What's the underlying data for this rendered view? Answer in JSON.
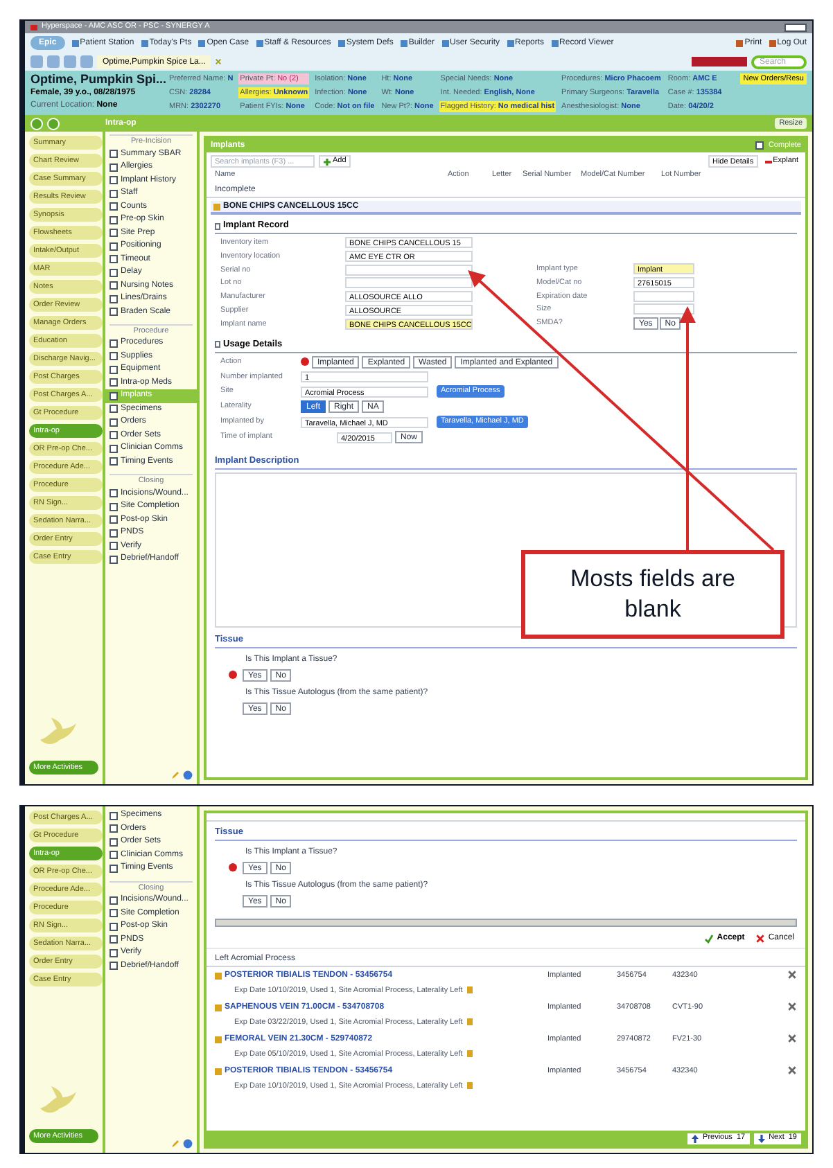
{
  "window_title": "Hyperspace - AMC ASC OR - PSC - SYNERGY A",
  "toolbar": {
    "logo": "Epic",
    "items": [
      "Patient Station",
      "Today's Pts",
      "Open Case",
      "Staff & Resources",
      "System Defs",
      "Builder",
      "User Security",
      "Reports",
      "Record Viewer"
    ],
    "right": [
      "Print",
      "Log Out"
    ]
  },
  "patient_tab": "Optime,Pumpkin Spice La...",
  "search": {
    "placeholder": "Search"
  },
  "patient": {
    "name": "Optime, Pumpkin Spi...",
    "line": "Female, 39 y.o., 08/28/1975",
    "location_label": "Current Location:",
    "location": "None",
    "columns": [
      [
        {
          "label": "Preferred Name:",
          "value": "N",
          "kind": "plain"
        },
        {
          "label": "CSN:",
          "value": "28284",
          "kind": "plain"
        },
        {
          "label": "MRN:",
          "value": "2302270",
          "kind": "plain"
        }
      ],
      [
        {
          "label": "Private Pt:",
          "value": "No (2)",
          "kind": "alert"
        },
        {
          "label": "Allergies:",
          "value": "Unknown",
          "kind": "warning"
        },
        {
          "label": "Patient FYIs:",
          "value": "None",
          "kind": "plain"
        }
      ],
      [
        {
          "label": "Isolation:",
          "value": "None",
          "kind": "plain"
        },
        {
          "label": "Infection:",
          "value": "None",
          "kind": "plain"
        },
        {
          "label": "Code:",
          "value": "Not on file",
          "kind": "plain"
        }
      ],
      [
        {
          "label": "Ht:",
          "value": "None",
          "kind": "plain"
        },
        {
          "label": "Wt:",
          "value": "None",
          "kind": "plain"
        },
        {
          "label": "New Pt?:",
          "value": "None",
          "kind": "plain"
        }
      ],
      [
        {
          "label": "Special Needs:",
          "value": "None",
          "kind": "plain"
        },
        {
          "label": "Int. Needed:",
          "value": "English, None",
          "kind": "plain"
        },
        {
          "label": "Flagged History:",
          "value": "No medical hist",
          "kind": "warning"
        }
      ],
      [
        {
          "label": "Procedures:",
          "value": "Micro Phacoem",
          "kind": "plain"
        },
        {
          "label": "Primary Surgeons:",
          "value": "Taravella",
          "kind": "plain"
        },
        {
          "label": "Anesthesiologist:",
          "value": "None",
          "kind": "plain"
        }
      ],
      [
        {
          "label": "Room:",
          "value": "AMC E",
          "kind": "plain"
        },
        {
          "label": "Case #:",
          "value": "135384",
          "kind": "plain"
        },
        {
          "label": "Date:",
          "value": "04/20/2",
          "kind": "plain"
        }
      ]
    ],
    "badge": "New Orders/Resu"
  },
  "activity": {
    "title": "Intra-op",
    "resize": "Resize"
  },
  "nav": [
    {
      "label": "Summary",
      "selected": false
    },
    {
      "label": "Chart Review",
      "selected": false
    },
    {
      "label": "Case Summary",
      "selected": false
    },
    {
      "label": "Results Review",
      "selected": false
    },
    {
      "label": "Synopsis",
      "selected": false
    },
    {
      "label": "Flowsheets",
      "selected": false
    },
    {
      "label": "Intake/Output",
      "selected": false
    },
    {
      "label": "MAR",
      "selected": false
    },
    {
      "label": "Notes",
      "selected": false
    },
    {
      "label": "Order Review",
      "selected": false
    },
    {
      "label": "Manage Orders",
      "selected": false
    },
    {
      "label": "Education",
      "selected": false
    },
    {
      "label": "Discharge Navig...",
      "selected": false
    },
    {
      "label": "Post Charges",
      "selected": false
    },
    {
      "label": "Post Charges A...",
      "selected": false
    },
    {
      "label": "Gt Procedure",
      "selected": false
    },
    {
      "label": "Intra-op",
      "selected": true
    },
    {
      "label": "OR Pre-op Che...",
      "selected": false
    },
    {
      "label": "Procedure Ade...",
      "selected": false
    },
    {
      "label": "Procedure",
      "selected": false
    },
    {
      "label": "RN Sign...",
      "selected": false
    },
    {
      "label": "Sedation Narra...",
      "selected": false
    },
    {
      "label": "Order Entry",
      "selected": false
    },
    {
      "label": "Case Entry",
      "selected": false
    }
  ],
  "more_activities": "More Activities",
  "checklist": [
    {
      "title": "Pre-Incision",
      "items": [
        {
          "label": "Summary SBAR",
          "checked": false,
          "selected": false
        },
        {
          "label": "Allergies",
          "checked": false,
          "selected": false
        },
        {
          "label": "Implant History",
          "checked": false,
          "selected": false
        },
        {
          "label": "Staff",
          "checked": false,
          "selected": false
        },
        {
          "label": "Counts",
          "checked": false,
          "selected": false
        },
        {
          "label": "Pre-op Skin",
          "checked": false,
          "selected": false
        },
        {
          "label": "Site Prep",
          "checked": false,
          "selected": false
        },
        {
          "label": "Positioning",
          "checked": false,
          "selected": false
        },
        {
          "label": "Timeout",
          "checked": false,
          "selected": false
        },
        {
          "label": "Delay",
          "checked": false,
          "selected": false
        },
        {
          "label": "Nursing Notes",
          "checked": false,
          "selected": false
        },
        {
          "label": "Lines/Drains",
          "checked": false,
          "selected": false
        },
        {
          "label": "Braden Scale",
          "checked": false,
          "selected": false
        }
      ]
    },
    {
      "title": "Procedure",
      "items": [
        {
          "label": "Procedures",
          "checked": false,
          "selected": false
        },
        {
          "label": "Supplies",
          "checked": false,
          "selected": false
        },
        {
          "label": "Equipment",
          "checked": false,
          "selected": false
        },
        {
          "label": "Intra-op Meds",
          "checked": false,
          "selected": false
        },
        {
          "label": "Implants",
          "checked": false,
          "selected": true
        },
        {
          "label": "Specimens",
          "checked": false,
          "selected": false
        },
        {
          "label": "Orders",
          "checked": false,
          "selected": false
        },
        {
          "label": "Order Sets",
          "checked": false,
          "selected": false
        },
        {
          "label": "Clinician Comms",
          "checked": false,
          "selected": false
        },
        {
          "label": "Timing Events",
          "checked": false,
          "selected": false
        }
      ]
    },
    {
      "title": "Closing",
      "items": [
        {
          "label": "Incisions/Wound...",
          "checked": false,
          "selected": false
        },
        {
          "label": "Site Completion",
          "checked": false,
          "selected": false
        },
        {
          "label": "Post-op Skin",
          "checked": false,
          "selected": false
        },
        {
          "label": "PNDS",
          "checked": false,
          "selected": false
        },
        {
          "label": "Verify",
          "checked": false,
          "selected": false
        },
        {
          "label": "Debrief/Handoff",
          "checked": false,
          "selected": false
        }
      ]
    }
  ],
  "implants": {
    "title": "Implants",
    "complete": {
      "label": "Complete",
      "checked": false
    },
    "search_placeholder": "Search implants (F3) ...",
    "add": "Add",
    "hide_details": "Hide Details",
    "explant": "Explant",
    "columns": [
      "Name",
      "Action",
      "Letter",
      "Serial Number",
      "Model/Cat Number",
      "Lot Number"
    ],
    "status": "Incomplete",
    "item": "BONE CHIPS CANCELLOUS 15CC",
    "record_title": "Implant Record",
    "record_left": [
      {
        "label": "Inventory item",
        "value": "BONE CHIPS CANCELLOUS 15",
        "highlighted": false
      },
      {
        "label": "Inventory location",
        "value": "AMC EYE CTR OR",
        "highlighted": false
      },
      {
        "label": "Serial no",
        "highlighted": false
      },
      {
        "label": "Lot no",
        "highlighted": false
      },
      {
        "label": "Manufacturer",
        "value": "ALLOSOURCE ALLO",
        "highlighted": false
      },
      {
        "label": "Supplier",
        "value": "ALLOSOURCE",
        "highlighted": false
      },
      {
        "label": "Implant name",
        "value": "BONE CHIPS CANCELLOUS 15CC",
        "highlighted": true
      }
    ],
    "record_right": [
      {
        "kind": "field",
        "label": "Implant type",
        "value": "Implant",
        "highlighted": true
      },
      {
        "kind": "field",
        "label": "Model/Cat no",
        "value": "27615015",
        "highlighted": false
      },
      {
        "kind": "field",
        "label": "Expiration date",
        "highlighted": false
      },
      {
        "kind": "field",
        "label": "Size",
        "highlighted": false
      },
      {
        "kind": "choice",
        "label": "SMDA?",
        "options": [
          "Yes",
          "No"
        ]
      }
    ],
    "usage_title": "Usage Details",
    "usage": [
      {
        "kind": "choice",
        "label": "Action",
        "required": true,
        "options": [
          {
            "label": "Implanted",
            "selected": false
          },
          {
            "label": "Explanted",
            "selected": false
          },
          {
            "label": "Wasted",
            "selected": false
          },
          {
            "label": "Implanted and Explanted",
            "selected": false
          }
        ]
      },
      {
        "kind": "field",
        "label": "Number implanted",
        "value": "1"
      },
      {
        "kind": "field_button",
        "label": "Site",
        "value": "Acromial Process",
        "button": "Acromial Process"
      },
      {
        "kind": "toggle",
        "label": "Laterality",
        "options": [
          {
            "label": "Left",
            "selected": true
          },
          {
            "label": "Right",
            "selected": false
          },
          {
            "label": "NA",
            "selected": false
          }
        ]
      },
      {
        "kind": "field_button",
        "label": "Implanted by",
        "value": "Taravella, Michael J, MD",
        "button": "Taravella, Michael J, MD"
      },
      {
        "kind": "time",
        "label": "Time of implant",
        "value": "4/20/2015",
        "button": "Now"
      }
    ],
    "description_title": "Implant Description",
    "tissue_title": "Tissue",
    "tissue": [
      {
        "question": "Is This Implant a Tissue?",
        "required": true,
        "options": [
          "Yes",
          "No"
        ]
      },
      {
        "question": "Is This Tissue Autologus (from the same patient)?",
        "required": false,
        "options": [
          "Yes",
          "No"
        ]
      }
    ]
  },
  "callout": "Mosts fields are blank",
  "lower": {
    "nav": [
      {
        "label": "Post Charges A...",
        "selected": false
      },
      {
        "label": "Gt Procedure",
        "selected": false
      },
      {
        "label": "Intra-op",
        "selected": true
      },
      {
        "label": "OR Pre-op Che...",
        "selected": false
      },
      {
        "label": "Procedure Ade...",
        "selected": false
      },
      {
        "label": "Procedure",
        "selected": false
      },
      {
        "label": "RN Sign...",
        "selected": false
      },
      {
        "label": "Sedation Narra...",
        "selected": false
      },
      {
        "label": "Order Entry",
        "selected": false
      },
      {
        "label": "Case Entry",
        "selected": false
      }
    ],
    "more_activities": "More Activities",
    "checklist": [
      {
        "items": [
          {
            "label": "Specimens",
            "checked": false,
            "selected": false
          },
          {
            "label": "Orders",
            "checked": false,
            "selected": false
          },
          {
            "label": "Order Sets",
            "checked": false,
            "selected": false
          },
          {
            "label": "Clinician Comms",
            "checked": false,
            "selected": false
          },
          {
            "label": "Timing Events",
            "checked": false,
            "selected": false
          }
        ]
      },
      {
        "title": "Closing",
        "items": [
          {
            "label": "Incisions/Wound...",
            "checked": false,
            "selected": false
          },
          {
            "label": "Site Completion",
            "checked": false,
            "selected": false
          },
          {
            "label": "Post-op Skin",
            "checked": false,
            "selected": false
          },
          {
            "label": "PNDS",
            "checked": false,
            "selected": false
          },
          {
            "label": "Verify",
            "checked": false,
            "selected": false
          },
          {
            "label": "Debrief/Handoff",
            "checked": false,
            "selected": false
          }
        ]
      }
    ],
    "tissue_title": "Tissue",
    "tissue": [
      {
        "question": "Is This Implant a Tissue?",
        "required": true,
        "options": [
          "Yes",
          "No"
        ]
      },
      {
        "question": "Is This Tissue Autologus (from the same patient)?",
        "required": false,
        "options": [
          "Yes",
          "No"
        ]
      }
    ],
    "accept": "Accept",
    "cancel": "Cancel",
    "group": "Left Acromial Process",
    "rows": [
      {
        "name": "POSTERIOR TIBIALIS TENDON - 53456754",
        "details": "Exp Date 10/10/2019, Used 1, Site Acromial Process, Laterality Left",
        "status": "Implanted",
        "serial": "3456754",
        "lot": "432340"
      },
      {
        "name": "SAPHENOUS VEIN 71.00CM - 534708708",
        "details": "Exp Date 03/22/2019, Used 1, Site Acromial Process, Laterality Left",
        "status": "Implanted",
        "serial": "34708708",
        "lot": "CVT1-90"
      },
      {
        "name": "FEMORAL VEIN 21.30CM - 529740872",
        "details": "Exp Date 05/10/2019, Used 1, Site Acromial Process, Laterality Left",
        "status": "Implanted",
        "serial": "29740872",
        "lot": "FV21-30"
      },
      {
        "name": "POSTERIOR TIBIALIS TENDON - 53456754",
        "details": "Exp Date 10/10/2019, Used 1, Site Acromial Process, Laterality Left",
        "status": "Implanted",
        "serial": "3456754",
        "lot": "432340"
      }
    ],
    "previous": "Previous",
    "previous_count": "17",
    "next": "Next",
    "next_count": "19"
  }
}
